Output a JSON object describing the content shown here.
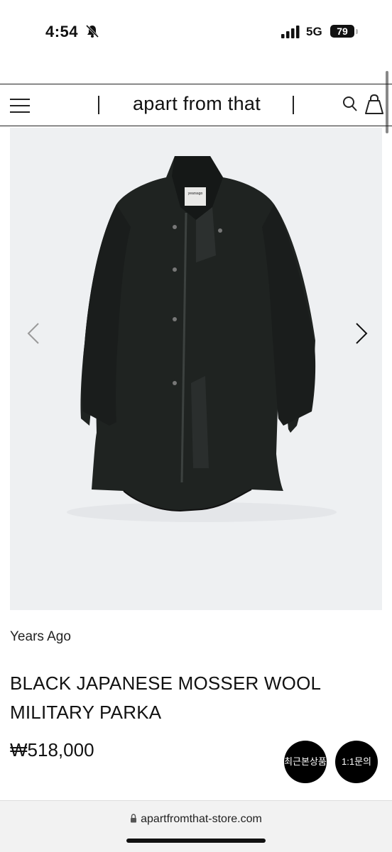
{
  "status_bar": {
    "time": "4:54",
    "network": "5G",
    "battery": "79"
  },
  "header": {
    "brand": "apart from that"
  },
  "icons": {
    "menu": "hamburger-menu-icon",
    "search": "search-icon",
    "bag": "shopping-bag-icon",
    "prev": "chevron-left-icon",
    "next": "chevron-right-icon",
    "lock": "lock-icon"
  },
  "product": {
    "brand": "Years Ago",
    "title": "BLACK JAPANESE MOSSER WOOL MILITARY PARKA",
    "price": "₩518,000",
    "image_label_tag": "yearsago"
  },
  "floating": {
    "recent_label": "최근본상품",
    "inquiry_label": "1:1문의"
  },
  "browser": {
    "url": "apartfromthat-store.com"
  }
}
